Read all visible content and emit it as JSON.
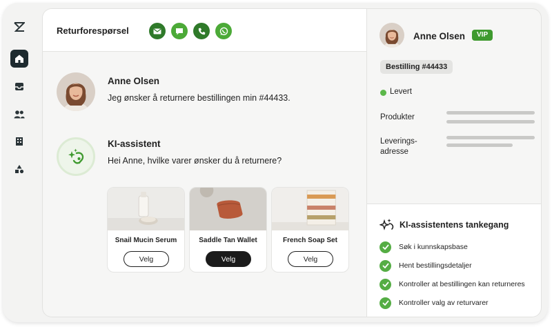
{
  "header": {
    "title": "Returforespørsel",
    "channels": [
      {
        "name": "email",
        "color": "#2f7a2a"
      },
      {
        "name": "chat",
        "color": "#4caa38"
      },
      {
        "name": "phone",
        "color": "#2f7a2a"
      },
      {
        "name": "whatsapp",
        "color": "#4caa38"
      }
    ]
  },
  "conversation": {
    "customer": {
      "name": "Anne Olsen",
      "message": "Jeg ønsker å returnere bestillingen min #44433."
    },
    "assistant": {
      "name": "KI-assistent",
      "message": "Hei Anne, hvilke varer ønsker du å returnere?"
    },
    "products": [
      {
        "name": "Snail Mucin Serum",
        "button": "Velg",
        "selected": false
      },
      {
        "name": "Saddle Tan Wallet",
        "button": "Velg",
        "selected": true
      },
      {
        "name": "French Soap Set",
        "button": "Velg",
        "selected": false
      }
    ]
  },
  "customer_panel": {
    "name": "Anne Olsen",
    "badge": "VIP",
    "order": "Bestilling #44433",
    "status": "Levert",
    "fields": [
      {
        "label": "Produkter"
      },
      {
        "label": "Leverings-\nadresse"
      }
    ]
  },
  "thinking": {
    "title": "KI-assistentens tankegang",
    "steps": [
      "Søk i kunnskapsbase",
      "Hent bestillingsdetaljer",
      "Kontroller at bestillingen kan returneres",
      "Kontroller valg av returvarer"
    ]
  },
  "colors": {
    "accent_green": "#55ad44",
    "rail_active": "#1e2b30"
  }
}
